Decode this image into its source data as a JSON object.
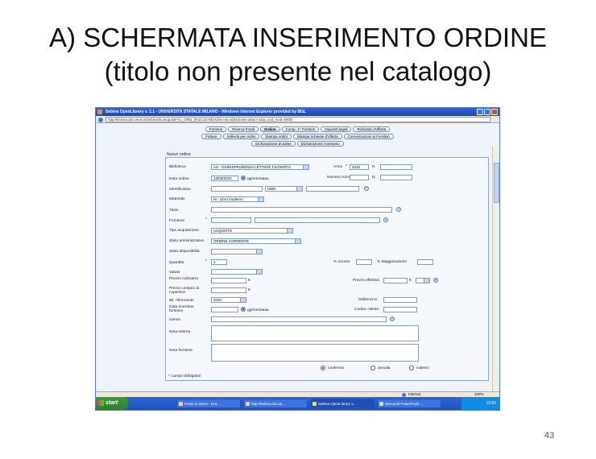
{
  "slide": {
    "title_line1": "A) SCHERMATA INSERIMENTO ORDINE",
    "title_line2": "(titolo non presente nel catalogo)",
    "page_number": "43"
  },
  "browser": {
    "window_title": "Sebina OpenLibrary v. 2.1 - UNIVERSITA STATALE MILANO - Windows Internet Explorer provided by BGL",
    "url": "http://fedora.dsi.unimi.it/SebinaOL/acquisti/AC_ORD_0010.do?idOrdine=&codSezione=&tipo=1&a_cod_mod=MOD"
  },
  "nav_row1": [
    "Fornitori",
    "Ricerca Fondi",
    "Ordine",
    "Comp. 1^ Fornitori",
    "Depositi legali",
    "Richieste d'offerta"
  ],
  "nav_row2": [
    "Fatture",
    "Solleciti per ordini",
    "Stampa ordini",
    "Stampa richieste d'offerta",
    "Comunicazioni ai Fornitori"
  ],
  "nav_row3": [
    "Dichiarazione d'ordine",
    "Dichiarazione inventario"
  ],
  "form": {
    "section_title": "Nuovo ordine",
    "labels": {
      "biblioteca": "Biblioteca",
      "data_ordine": "Data ordine",
      "identificativo": "Identificativo",
      "materiale": "Materiale",
      "titolo": "Titolo",
      "fornitore": "Fornitore",
      "tipo_acquisizione": "Tipo acquisizione",
      "stato_amministrativo": "Stato amministrativo",
      "stato_disponibilita": "Stato disponibilità",
      "quantita": "Quantità",
      "valuta": "Valuta",
      "prezzo_indicativo": "Prezzo indicativo",
      "prezzo_unitario": "Prezzo unitario di copertina",
      "bil_riferimento": "Bil. riferimento",
      "data_ricezione": "Data ricezione fornitore",
      "utente": "Utente",
      "nota_interna": "Nota interna",
      "nota_fornitore": "Nota fornitore",
      "anno": "Anno",
      "numero_anno": "Numero Anno",
      "sconto": "% Sconto",
      "maggiorazione": "% Maggiorazione",
      "prezzo_effettivo": "Prezzo effettivo",
      "delibera": "Delibera N.",
      "codice_cliente": "Codice cliente",
      "campi_obbligatori": "* Campi obbligatori"
    },
    "values": {
      "biblioteca": "AS - GIURISPRUDENZA LETTERE FILOSOFIA",
      "data_ordine": "13/03/2010",
      "date_format": "gg/mm/aaaa",
      "identificativo_tipo": "ISBN",
      "materiale": "M - Libro moderno",
      "tipo_acquisizione": "ACQUISTO",
      "stato_amministrativo": "ORDINE CORRENTE",
      "quantita": "1",
      "anno": "2010",
      "bil_riferimento": "2010",
      "currency": "€"
    },
    "actions": {
      "conferma": "conferma",
      "annulla": "annulla",
      "indietro": "indietro"
    }
  },
  "statusbar": {
    "zone": "Internet",
    "zoom": "100%"
  },
  "taskbar": {
    "start": "start",
    "items": [
      "Posta in arrivo - Out...",
      "http://fedora.dsi.uni...",
      "Sebina OpenLibrary v...",
      "Microsoft PowerPoint ..."
    ],
    "clock": "15:50"
  }
}
